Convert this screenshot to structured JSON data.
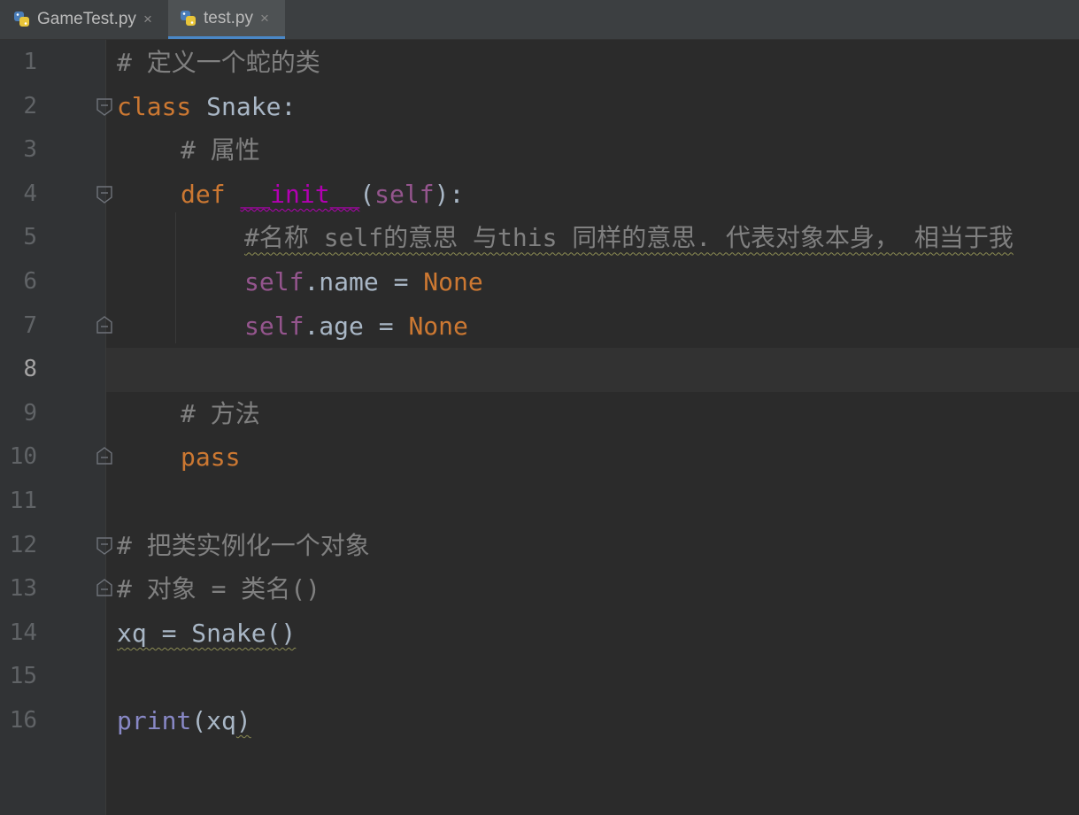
{
  "tabs": [
    {
      "name": "GameTest.py",
      "close": "×",
      "icon": "python-file-icon"
    },
    {
      "name": "test.py",
      "close": "×",
      "icon": "python-file-icon"
    }
  ],
  "line_numbers": [
    "1",
    "2",
    "3",
    "4",
    "5",
    "6",
    "7",
    "8",
    "9",
    "10",
    "11",
    "12",
    "13",
    "14",
    "15",
    "16"
  ],
  "code": {
    "l1_comment": "# 定义一个蛇的类",
    "l2_kw": "class",
    "l2_rest": " Snake:",
    "l3_comment": "# 属性",
    "l4_def": "def",
    "l4_name": "__init__",
    "l4_open": "(",
    "l4_self": "self",
    "l4_close": "):",
    "l5_comment": "#名称 self的意思 与this 同样的意思. 代表对象本身， 相当于我",
    "l6_self": "self",
    "l6_mid": ".name = ",
    "l6_none": "None",
    "l7_self": "self",
    "l7_mid": ".age = ",
    "l7_none": "None",
    "l9_comment": "# 方法",
    "l10_pass": "pass",
    "l12_comment": "# 把类实例化一个对象",
    "l13_comment": "# 对象 = 类名()",
    "l14": "xq = Snake()",
    "l16_print": "print",
    "l16_open": "(",
    "l16_arg": "xq",
    "l16_close": ")"
  },
  "colors": {
    "background": "#2b2b2b",
    "keyword": "#cc7832",
    "comment": "#808080",
    "self": "#94558d",
    "magic": "#b200b2",
    "builtin": "#8888c6",
    "text": "#a9b7c6",
    "active_tab_underline": "#4a88c7"
  }
}
